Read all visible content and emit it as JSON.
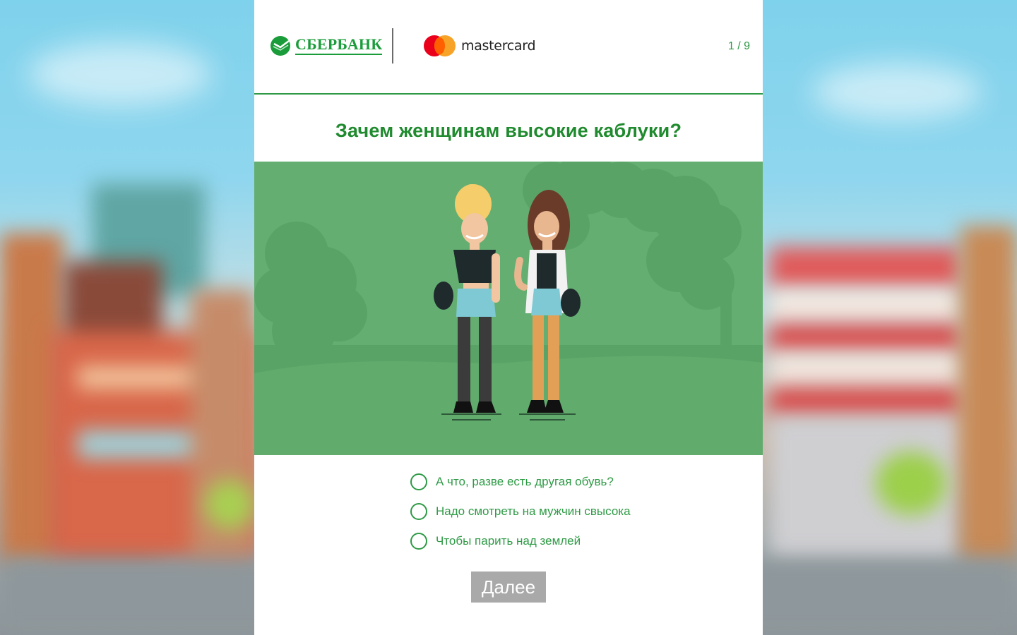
{
  "header": {
    "bank_name": "СБЕРБАНК",
    "partner_name": "mastercard",
    "progress": "1 / 9"
  },
  "quiz": {
    "question": "Зачем женщинам высокие каблуки?",
    "options": [
      {
        "label": "А что, разве есть другая обувь?"
      },
      {
        "label": "Надо смотреть на мужчин свысока"
      },
      {
        "label": "Чтобы парить над землей"
      }
    ],
    "next_label": "Далее"
  },
  "colors": {
    "brand_green": "#1a9c3a",
    "illustration_bg": "#65ae72",
    "button_disabled": "#a9a9a9"
  }
}
